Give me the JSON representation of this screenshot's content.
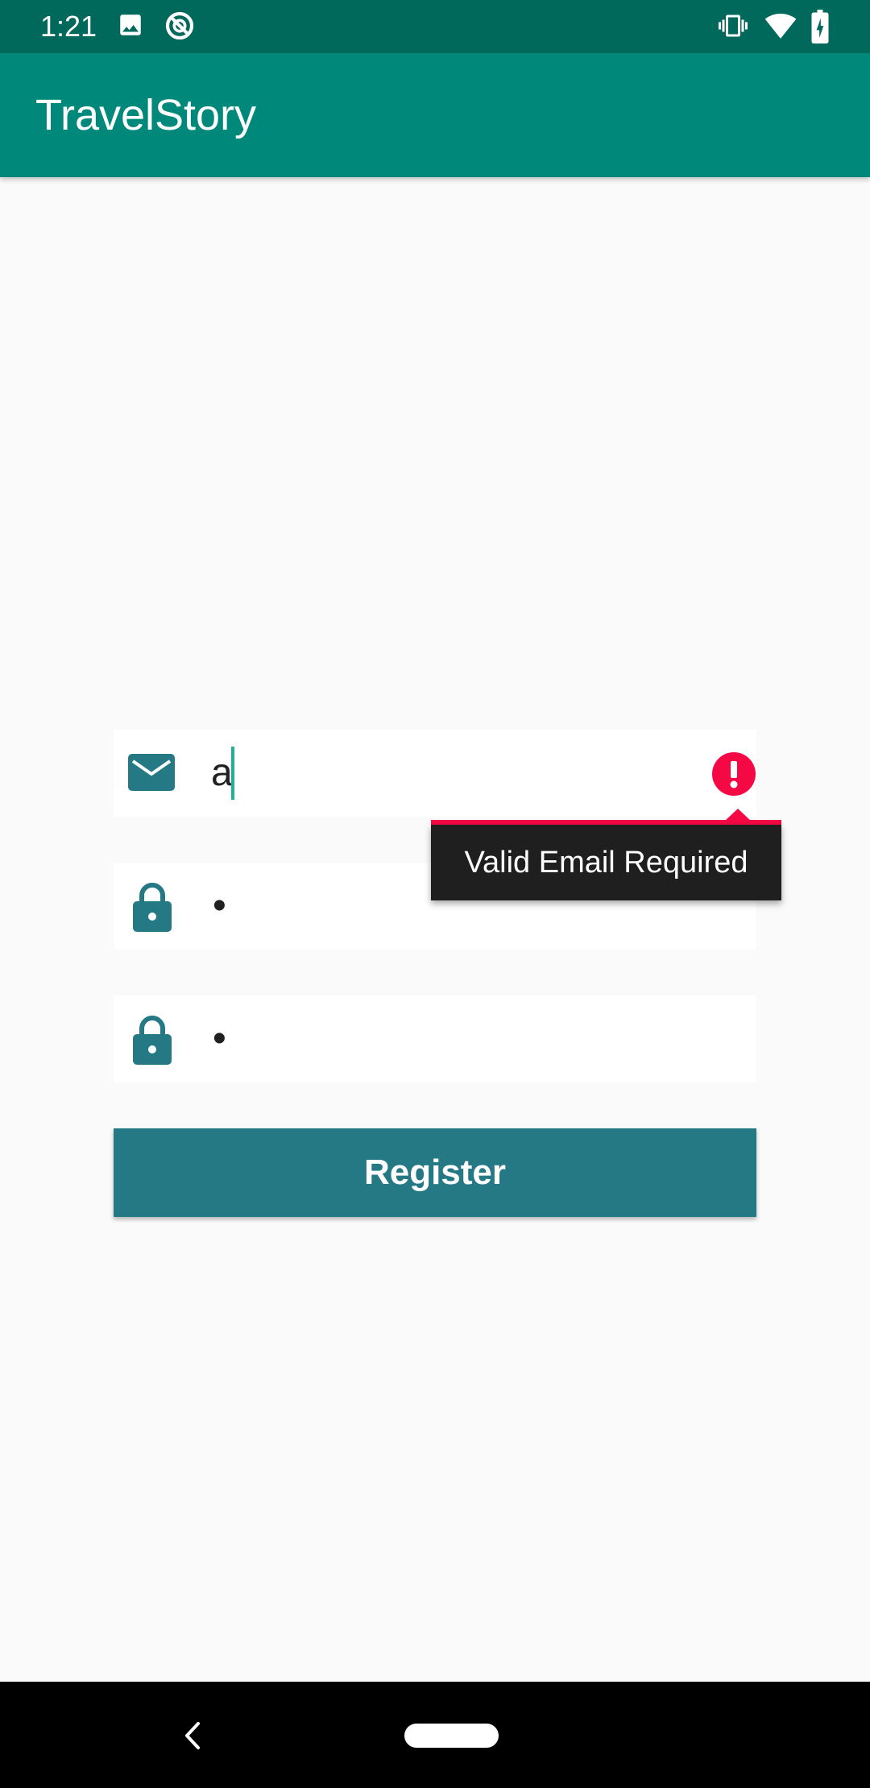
{
  "status_bar": {
    "time": "1:21",
    "left_icons": [
      "image-icon",
      "sync-disabled-icon"
    ],
    "right_icons": [
      "vibrate-icon",
      "wifi-icon",
      "battery-charging-icon"
    ]
  },
  "app_bar": {
    "title": "TravelStory"
  },
  "form": {
    "email": {
      "icon": "email-icon",
      "value": "a",
      "error": "Valid Email Required",
      "error_icon": "error-icon"
    },
    "password": {
      "icon": "lock-icon",
      "value": "•"
    },
    "confirm_password": {
      "icon": "lock-icon",
      "value": "•"
    },
    "register_label": "Register"
  },
  "nav_bar": {
    "icons": [
      "back-icon",
      "home-pill-icon"
    ]
  },
  "colors": {
    "status_bar": "#00695c",
    "app_bar": "#00897b",
    "accent": "#247985",
    "error": "#f50945",
    "cursor": "#1db394"
  }
}
